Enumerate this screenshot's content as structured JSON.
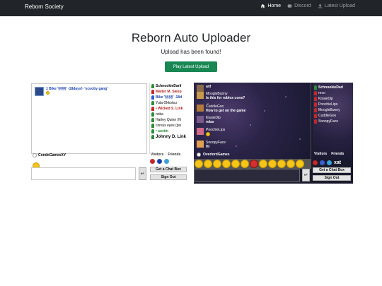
{
  "navbar": {
    "brand": "Reborn Society",
    "links": [
      {
        "label": "Home",
        "icon": "home-icon",
        "active": true
      },
      {
        "label": "Discord",
        "icon": "discord-icon",
        "active": false
      },
      {
        "label": "Latest Upload",
        "icon": "upload-icon",
        "active": false
      }
    ]
  },
  "main": {
    "title": "Reborn Auto Uploader",
    "subtitle": "Upload has been found!",
    "play_button": "Play Latest Upload"
  },
  "chat_left": {
    "message": {
      "number": "1",
      "name": "Bike '§§§§' -18days!- 'scooby gang'"
    },
    "users": [
      {
        "name": "SchnookieDarli",
        "color": "green"
      },
      {
        "name": "Matter M. Sleep",
        "color": "red"
      },
      {
        "name": "Bike '§§§§' -18d",
        "color": "blue"
      },
      {
        "name": "Yuta Okkotsu",
        "color": "green"
      },
      {
        "name": "• Wicked S. Link",
        "color": "red"
      },
      {
        "name": "noka",
        "color": "green"
      },
      {
        "name": "Harley Quinn (N",
        "color": "green"
      },
      {
        "name": "coreys eyes (pis",
        "color": "green"
      },
      {
        "name": "• austin",
        "color": "green"
      },
      {
        "name": "Johnny D. Link",
        "color": "green"
      }
    ],
    "tabs": [
      "Visitors",
      "Friends"
    ],
    "footer_user": "CondoGamesXY",
    "get_chat_box": "Get a Chat Box",
    "sign_out": "Sign Out",
    "enter": "↵"
  },
  "chat_right": {
    "messages": [
      {
        "name": "wtf",
        "text": ""
      },
      {
        "name": "MoogleBunny",
        "text": "Is this for roblox cons?"
      },
      {
        "name": "CuddleGoo",
        "text": "How to get on the game"
      },
      {
        "name": "KissieDip",
        "text": "relax"
      },
      {
        "name": "PoochieLips",
        "text": ""
      },
      {
        "name": "SnoopyFace",
        "text": "Hi"
      }
    ],
    "users": [
      {
        "name": "SchnookieDarl",
        "color": "green"
      },
      {
        "name": "reco",
        "color": "red"
      },
      {
        "name": "KissieDip",
        "color": "red"
      },
      {
        "name": "PoochieLips",
        "color": "red"
      },
      {
        "name": "MoogleBunny",
        "color": "red"
      },
      {
        "name": "CuddleGoo",
        "color": "red"
      },
      {
        "name": "SnoopyFace",
        "color": "red"
      }
    ],
    "tabs": [
      "Visitors",
      "Friends"
    ],
    "footer_user": "OverlordGames",
    "get_chat_box": "Get a Chat Box",
    "sign_out": "Sign Out",
    "enter": "↵",
    "brand": "xat"
  },
  "colors": {
    "navbar": "#212529",
    "play_button": "#198754"
  }
}
